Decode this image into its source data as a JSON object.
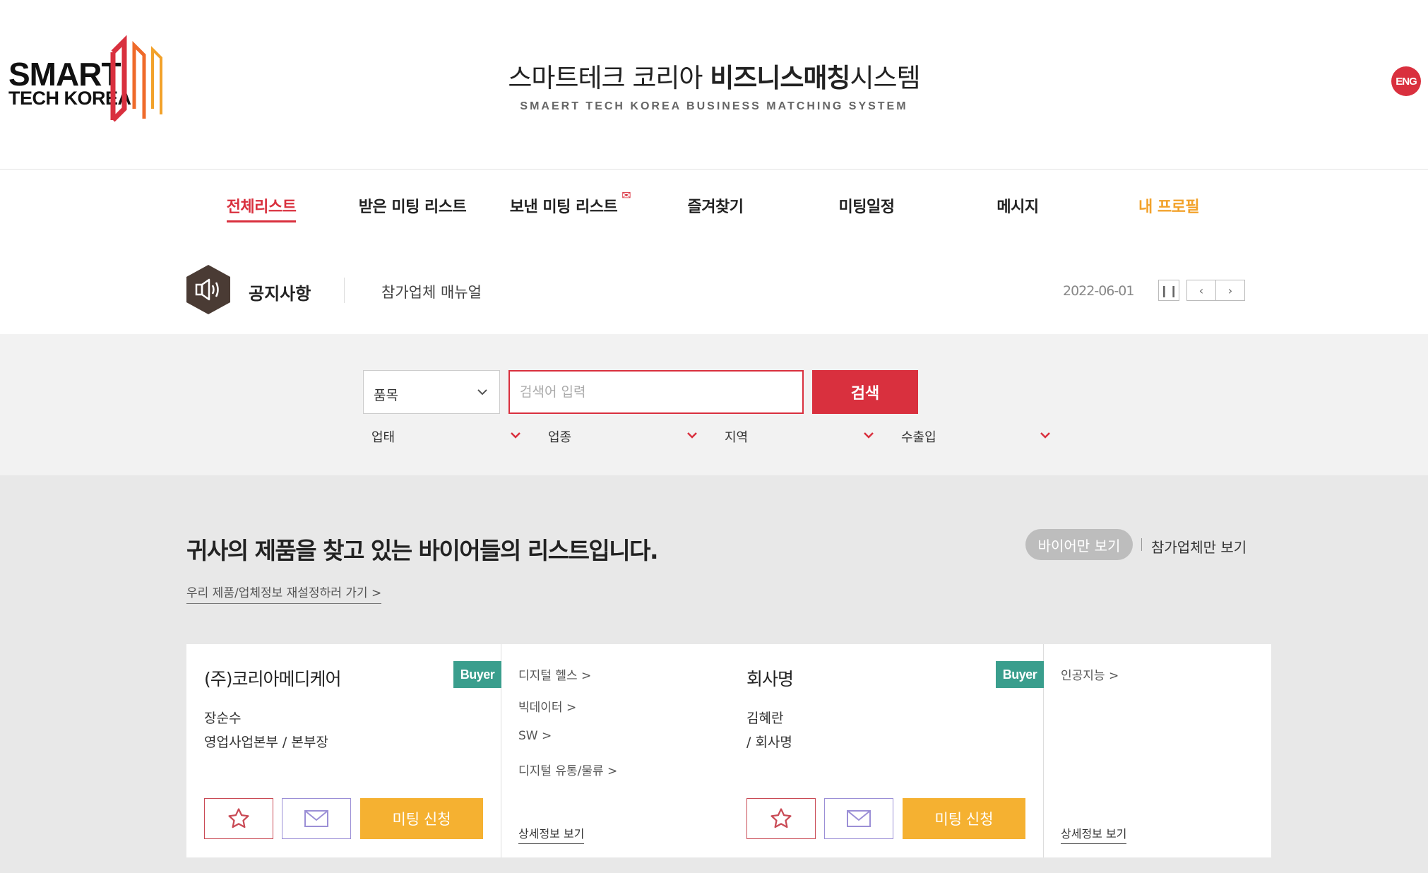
{
  "header": {
    "logo": {
      "line1": "SMART",
      "line2": "TECH KOREA"
    },
    "title_ko_normal1": "스마트테크 코리아 ",
    "title_ko_bold": "비즈니스매칭",
    "title_ko_normal2": "시스템",
    "title_en": "SMAERT TECH KOREA BUSINESS MATCHING SYSTEM",
    "lang_button": "ENG"
  },
  "nav": {
    "items": [
      {
        "label": "전체리스트",
        "state": "active"
      },
      {
        "label": "받은 미팅 리스트",
        "state": "normal"
      },
      {
        "label": "보낸 미팅 리스트",
        "state": "normal"
      },
      {
        "label": "즐겨찾기",
        "state": "normal"
      },
      {
        "label": "미팅일정",
        "state": "normal"
      },
      {
        "label": "메시지",
        "state": "normal"
      },
      {
        "label": "내 프로필",
        "state": "highlight"
      }
    ]
  },
  "notice": {
    "title": "공지사항",
    "text": "참가업체 매뉴얼",
    "date": "2022-06-01",
    "icon": "megaphone-icon"
  },
  "search": {
    "select_value": "품목",
    "placeholder": "검색어 입력",
    "button": "검색",
    "filters": [
      "업태",
      "업종",
      "지역",
      "수출입"
    ]
  },
  "list": {
    "heading": "귀사의 제품을 찾고 있는 바이어들의 리스트입니다.",
    "toggle_buyer": "바이어만 보기",
    "toggle_participant": "참가업체만 보기",
    "reset_link": "우리 제품/업체정보 재설정하러 가기 >",
    "cards": [
      {
        "company": "(주)코리아메디케어",
        "badge": "Buyer",
        "person": "장순수",
        "dept": "영업사업본부 / 본부장",
        "tags": [
          "디지털 헬스 >",
          "빅데이터 >",
          "SW >",
          "디지털 유통/물류 >"
        ],
        "meet_button": "미팅 신청",
        "detail_link": "상세정보 보기"
      },
      {
        "company": "회사명",
        "badge": "Buyer",
        "person": "김혜란",
        "dept": "/ 회사명",
        "tags": [
          "인공지능 >"
        ],
        "meet_button": "미팅 신청",
        "detail_link": "상세정보 보기"
      }
    ]
  },
  "colors": {
    "accent": "#d9303e",
    "orange": "#f5b131",
    "buyer_badge": "#3a9e8d",
    "notice_icon": "#4a3b34"
  }
}
